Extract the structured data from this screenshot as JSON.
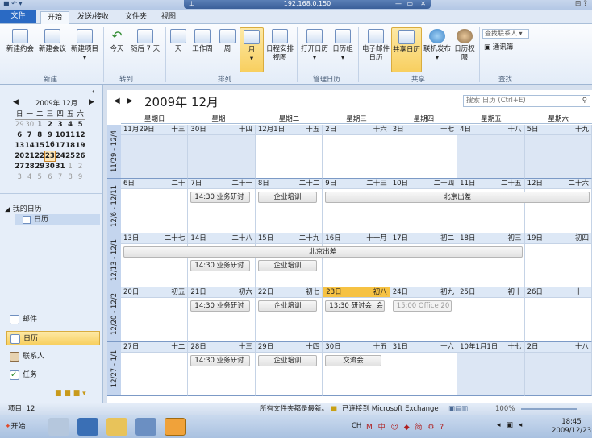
{
  "window": {
    "address": "192.168.0.150"
  },
  "tabs": [
    "文件",
    "开始",
    "发送/接收",
    "文件夹",
    "视图"
  ],
  "ribbon": {
    "groups": {
      "new": "新建",
      "goto": "转到",
      "arrange": "排列",
      "manage": "管理日历",
      "share": "共享",
      "find": "查找"
    },
    "new_appointment": "新建约会",
    "new_meeting": "新建会议",
    "new_items": "新建项目",
    "today": "今天",
    "next7": "随后 7 天",
    "day": "天",
    "workweek": "工作周",
    "week": "周",
    "month": "月",
    "schedule": "日程安排视图",
    "open_calendar": "打开日历",
    "calendar_group": "日历组",
    "email_calendar": "电子邮件日历",
    "share_calendar": "共享日历",
    "publish_online": "联机发布",
    "calendar_permissions": "日历权限",
    "search_contacts": "查找联系人",
    "address_book": "通讯簿"
  },
  "mini_calendar": {
    "title": "2009年 12月",
    "weekdays": [
      "日",
      "一",
      "二",
      "三",
      "四",
      "五",
      "六"
    ],
    "rows": [
      [
        "29",
        "30",
        "1",
        "2",
        "3",
        "4",
        "5"
      ],
      [
        "6",
        "7",
        "8",
        "9",
        "10",
        "11",
        "12"
      ],
      [
        "13",
        "14",
        "15",
        "16",
        "17",
        "18",
        "19"
      ],
      [
        "20",
        "21",
        "22",
        "23",
        "24",
        "25",
        "26"
      ],
      [
        "27",
        "28",
        "29",
        "30",
        "31",
        "1",
        "2"
      ],
      [
        "3",
        "4",
        "5",
        "6",
        "7",
        "8",
        "9"
      ]
    ],
    "selected": "23"
  },
  "nav": {
    "my_calendars": "我的日历",
    "calendar": "日历",
    "mail": "邮件",
    "calendar_btn": "日历",
    "contacts": "联系人",
    "tasks": "任务"
  },
  "calendar": {
    "title": "2009年 12月",
    "search_placeholder": "搜索 日历 (Ctrl+E)",
    "weekday_headers": [
      "星期日",
      "星期一",
      "星期二",
      "星期三",
      "星期四",
      "星期五",
      "星期六"
    ],
    "weeks": [
      {
        "label": "11/29 - 12/4",
        "days": [
          [
            "11月29日",
            "十三"
          ],
          [
            "30日",
            "十四"
          ],
          [
            "12月1日",
            "十五"
          ],
          [
            "2日",
            "十六"
          ],
          [
            "3日",
            "十七"
          ],
          [
            "4日",
            "十八"
          ],
          [
            "5日",
            "十九"
          ]
        ]
      },
      {
        "label": "12/6 - 12/11",
        "days": [
          [
            "6日",
            "二十"
          ],
          [
            "7日",
            "二十一"
          ],
          [
            "8日",
            "二十二"
          ],
          [
            "9日",
            "二十三"
          ],
          [
            "10日",
            "二十四"
          ],
          [
            "11日",
            "二十五"
          ],
          [
            "12日",
            "二十六"
          ]
        ]
      },
      {
        "label": "12/13 - 12/1",
        "days": [
          [
            "13日",
            "二十七"
          ],
          [
            "14日",
            "二十八"
          ],
          [
            "15日",
            "二十九"
          ],
          [
            "16日",
            "十一月"
          ],
          [
            "17日",
            "初二"
          ],
          [
            "18日",
            "初三"
          ],
          [
            "19日",
            "初四"
          ]
        ]
      },
      {
        "label": "12/20 - 12/2",
        "days": [
          [
            "20日",
            "初五"
          ],
          [
            "21日",
            "初六"
          ],
          [
            "22日",
            "初七"
          ],
          [
            "23日",
            "初八"
          ],
          [
            "24日",
            "初九"
          ],
          [
            "25日",
            "初十"
          ],
          [
            "26日",
            "十一"
          ]
        ]
      },
      {
        "label": "12/27 - 1/1",
        "days": [
          [
            "27日",
            "十二"
          ],
          [
            "28日",
            "十三"
          ],
          [
            "29日",
            "十四"
          ],
          [
            "30日",
            "十五"
          ],
          [
            "31日",
            "十六"
          ],
          [
            "10年1月1日",
            "十七"
          ],
          [
            "2日",
            "十八"
          ]
        ]
      }
    ],
    "events": {
      "seminar": "14:30 业务研讨",
      "training": "企业培训",
      "beijing": "北京出差",
      "meeting": "13:30 研讨会; 会",
      "office": "15:00 Office 20",
      "exchange": "交流会"
    }
  },
  "status": {
    "items": "项目: 12",
    "updated": "所有文件夹都是最新。",
    "connected": "已连接到 Microsoft Exchange",
    "zoom": "100%"
  },
  "taskbar": {
    "start": "开始",
    "time": "18:45",
    "date": "2009/12/23",
    "lang": "CH"
  }
}
